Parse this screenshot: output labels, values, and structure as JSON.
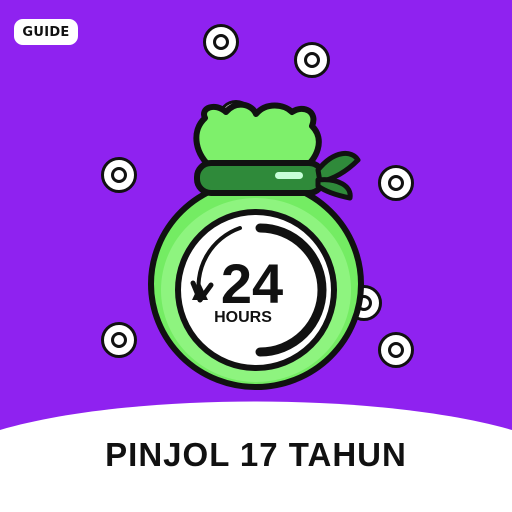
{
  "badge": {
    "label": "GUIDE"
  },
  "icon": {
    "clock_number": "24",
    "clock_unit": "HOURS",
    "bag_color": "#7cf06a",
    "background_color": "#8f22f0"
  },
  "footer": {
    "title": "PINJOL 17 TAHUN"
  }
}
